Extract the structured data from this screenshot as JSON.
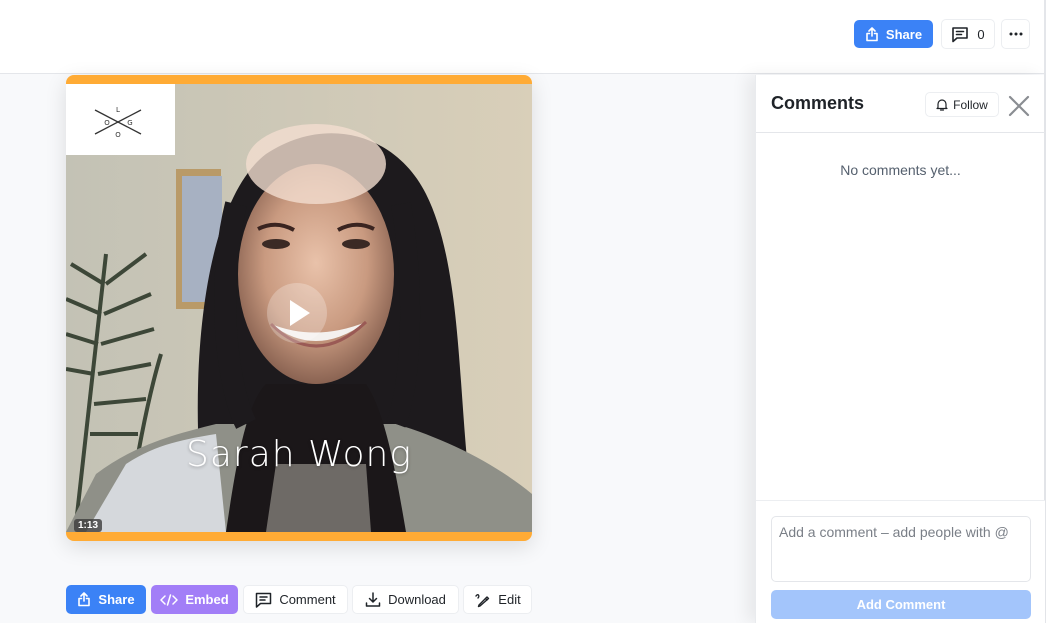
{
  "topbar": {
    "share_label": "Share",
    "comment_count": "0",
    "more_icon": "ellipsis-icon"
  },
  "video": {
    "caption": "Sarah Wong",
    "duration": "1:13",
    "logo_letters": [
      "L",
      "O",
      "G",
      "O"
    ],
    "accent_color": "#ffab35"
  },
  "actions": {
    "share_label": "Share",
    "embed_label": "Embed",
    "comment_label": "Comment",
    "download_label": "Download",
    "edit_label": "Edit"
  },
  "comments": {
    "title": "Comments",
    "follow_label": "Follow",
    "empty_text": "No comments yet...",
    "input_placeholder": "Add a comment – add people with @",
    "input_value": "",
    "submit_label": "Add Comment"
  },
  "colors": {
    "primary": "#3b82f6",
    "embed": "#a27ef7",
    "submit_disabled": "#a3c5fb"
  }
}
